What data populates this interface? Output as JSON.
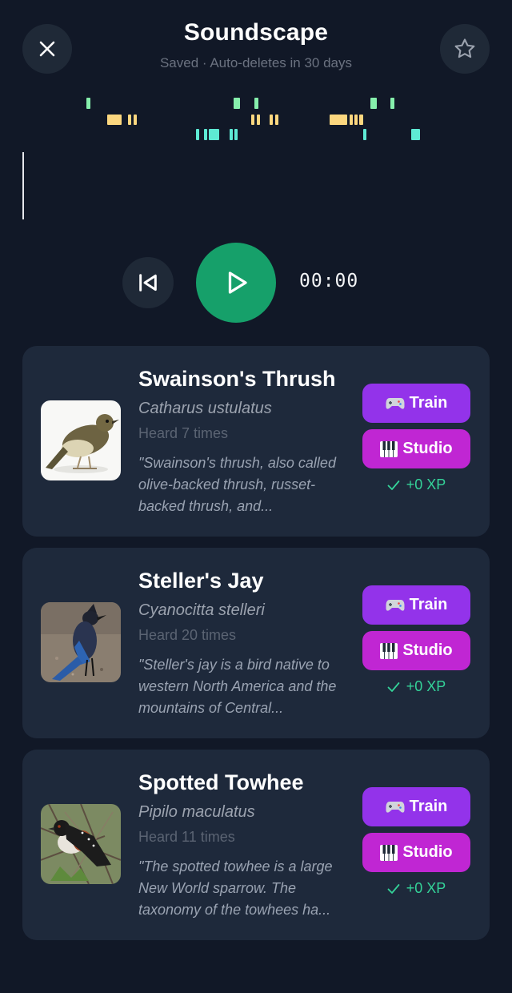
{
  "header": {
    "title": "Soundscape",
    "subtitle": "Saved · Auto-deletes in 30 days"
  },
  "icons": {
    "close": "close-icon",
    "favorite": "star-outline-icon",
    "restart": "skip-back-icon",
    "play": "play-icon",
    "train": "game-controller-icon",
    "studio": "piano-keys-icon",
    "xp": "check-icon"
  },
  "player": {
    "time": "00:00"
  },
  "colors": {
    "background": "#111827",
    "card": "#1e293b",
    "play": "#16a06a",
    "train": "#9333ea",
    "studio": "#c026d3",
    "xp": "#34d399",
    "spectrogram_green": "#86efac",
    "spectrogram_yellow": "#fcd77f",
    "spectrogram_teal": "#5eead4"
  },
  "birds": [
    {
      "name": "Swainson's Thrush",
      "scientific": "Catharus ustulatus",
      "heard": "Heard 7 times",
      "description": "\"Swainson's thrush, also called olive-backed thrush, russet-backed thrush, and...",
      "train_label": "Train",
      "studio_label": "Studio",
      "xp_label": "+0 XP"
    },
    {
      "name": "Steller's Jay",
      "scientific": "Cyanocitta stelleri",
      "heard": "Heard 20 times",
      "description": "\"Steller's jay is a bird native to western North America and the mountains of Central...",
      "train_label": "Train",
      "studio_label": "Studio",
      "xp_label": "+0 XP"
    },
    {
      "name": "Spotted Towhee",
      "scientific": "Pipilo maculatus",
      "heard": "Heard 11 times",
      "description": "\"The spotted towhee is a large New World sparrow. The taxonomy of the towhees ha...",
      "train_label": "Train",
      "studio_label": "Studio",
      "xp_label": "+0 XP"
    }
  ]
}
